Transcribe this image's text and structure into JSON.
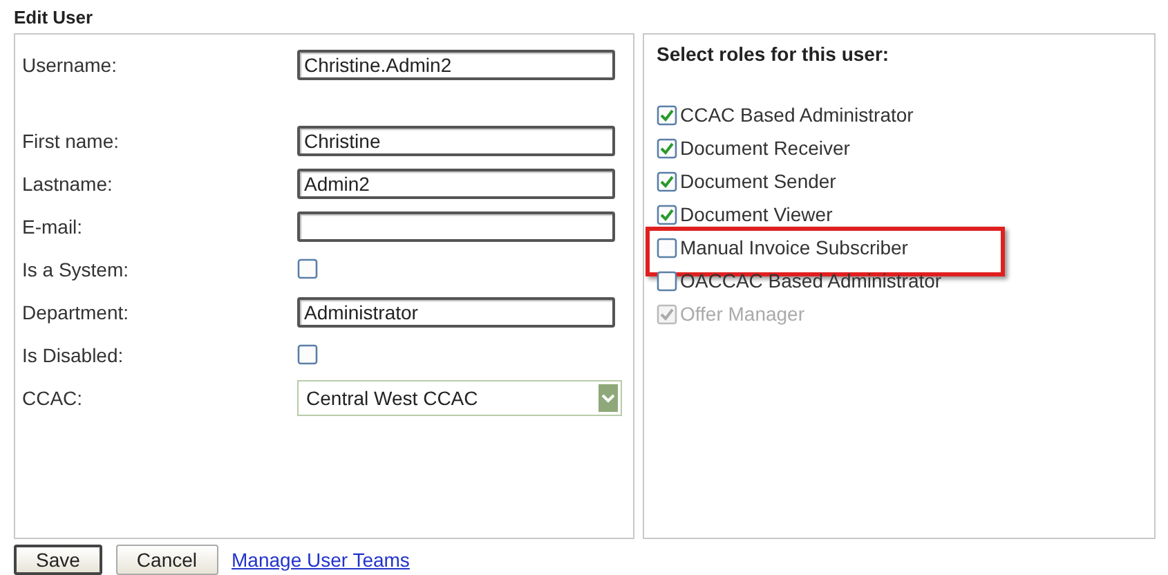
{
  "title": "Edit User",
  "fields": [
    {
      "label": "Username:",
      "kind": "text",
      "value": "Christine.Admin2"
    },
    {
      "label": "First name:",
      "kind": "text",
      "value": "Christine"
    },
    {
      "label": "Lastname:",
      "kind": "text",
      "value": "Admin2"
    },
    {
      "label": "E-mail:",
      "kind": "text"
    },
    {
      "label": "Is a System:",
      "kind": "checkbox",
      "checked": false
    },
    {
      "label": "Department:",
      "kind": "text",
      "value": "Administrator"
    },
    {
      "label": "Is Disabled:",
      "kind": "checkbox",
      "checked": false
    },
    {
      "label": "CCAC:",
      "kind": "select",
      "value": "Central West CCAC"
    }
  ],
  "roles_heading": "Select roles for this user:",
  "roles": [
    {
      "label": "CCAC Based Administrator",
      "checked": true,
      "disabled": false,
      "highlighted": false
    },
    {
      "label": "Document Receiver",
      "checked": true,
      "disabled": false,
      "highlighted": false
    },
    {
      "label": "Document Sender",
      "checked": true,
      "disabled": false,
      "highlighted": false
    },
    {
      "label": "Document Viewer",
      "checked": true,
      "disabled": false,
      "highlighted": false
    },
    {
      "label": "Manual Invoice Subscriber",
      "checked": false,
      "disabled": false,
      "highlighted": true
    },
    {
      "label": "OACCAC Based Administrator",
      "checked": false,
      "disabled": false,
      "highlighted": false
    },
    {
      "label": "Offer Manager",
      "checked": true,
      "disabled": true,
      "highlighted": false
    }
  ],
  "buttons": [
    {
      "label": "Save",
      "kind": "default"
    },
    {
      "label": "Cancel",
      "kind": "normal"
    }
  ],
  "link": "Manage User Teams"
}
